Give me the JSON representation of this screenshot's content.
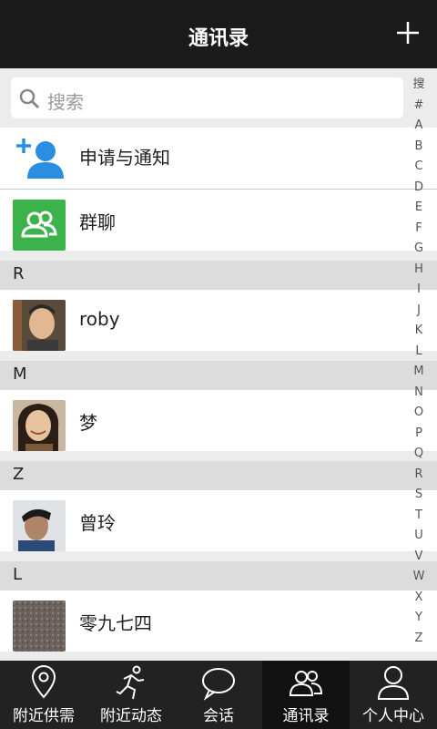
{
  "header": {
    "title": "通讯录"
  },
  "search": {
    "placeholder": "搜索"
  },
  "items": [
    {
      "label": "申请与通知"
    },
    {
      "label": "群聊"
    }
  ],
  "sections": [
    {
      "letter": "R",
      "contact": "roby"
    },
    {
      "letter": "M",
      "contact": "梦"
    },
    {
      "letter": "Z",
      "contact": "曾玲"
    },
    {
      "letter": "L",
      "contact": "零九七四"
    }
  ],
  "index": [
    "搜",
    "#",
    "A",
    "B",
    "C",
    "D",
    "E",
    "F",
    "G",
    "H",
    "I",
    "J",
    "K",
    "L",
    "M",
    "N",
    "O",
    "P",
    "Q",
    "R",
    "S",
    "T",
    "U",
    "V",
    "W",
    "X",
    "Y",
    "Z"
  ],
  "tabs": [
    {
      "label": "附近供需",
      "icon": "location-pin-icon"
    },
    {
      "label": "附近动态",
      "icon": "running-person-icon"
    },
    {
      "label": "会话",
      "icon": "chat-bubble-icon"
    },
    {
      "label": "通讯录",
      "icon": "contacts-icon",
      "active": true
    },
    {
      "label": "个人中心",
      "icon": "person-icon"
    }
  ],
  "colors": {
    "header": "#1b1b1b",
    "accent_blue": "#2a8fe0",
    "group_green": "#3cb34a"
  }
}
